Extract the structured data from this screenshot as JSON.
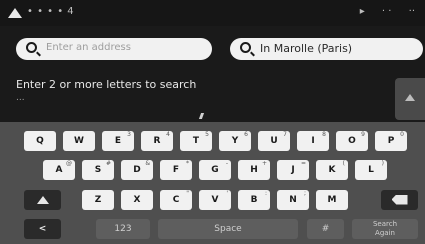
{
  "status_bar": {
    "left_text": "• • • • 4",
    "right_items": [
      "▸",
      "· ·",
      "··"
    ]
  },
  "search": {
    "address_placeholder": "Enter an address",
    "location_value": "In Marolle (Paris)"
  },
  "message": {
    "line1": "Enter 2 or more letters to search",
    "line2": "..."
  },
  "keyboard": {
    "row1": [
      {
        "label": "Q",
        "sup": ""
      },
      {
        "label": "W",
        "sup": ""
      },
      {
        "label": "E",
        "sup": "3"
      },
      {
        "label": "R",
        "sup": "4"
      },
      {
        "label": "T",
        "sup": "5"
      },
      {
        "label": "Y",
        "sup": "6"
      },
      {
        "label": "U",
        "sup": "7"
      },
      {
        "label": "I",
        "sup": "8"
      },
      {
        "label": "O",
        "sup": "9"
      },
      {
        "label": "P",
        "sup": "0"
      }
    ],
    "row2": [
      {
        "label": "A",
        "sup": "@"
      },
      {
        "label": "S",
        "sup": "#"
      },
      {
        "label": "D",
        "sup": "&"
      },
      {
        "label": "F",
        "sup": "*"
      },
      {
        "label": "G",
        "sup": "-"
      },
      {
        "label": "H",
        "sup": "+"
      },
      {
        "label": "J",
        "sup": "="
      },
      {
        "label": "K",
        "sup": "("
      },
      {
        "label": "L",
        "sup": ")"
      }
    ],
    "row3": [
      {
        "label": "Z",
        "sup": ""
      },
      {
        "label": "X",
        "sup": ""
      },
      {
        "label": "C",
        "sup": "\""
      },
      {
        "label": "V",
        "sup": "'"
      },
      {
        "label": "B",
        "sup": ":"
      },
      {
        "label": "N",
        "sup": ";"
      },
      {
        "label": "M",
        "sup": ""
      }
    ],
    "back_label": "<",
    "numbers_label": "123",
    "space_label": "Space",
    "hash_label": "#",
    "done_label": "Search\nAgain"
  },
  "colors": {
    "background": "#1a1a1a",
    "keyboard_bg": "#4f4f4f",
    "key_light": "#f1f1f1",
    "key_dark": "#2a2a2a"
  }
}
